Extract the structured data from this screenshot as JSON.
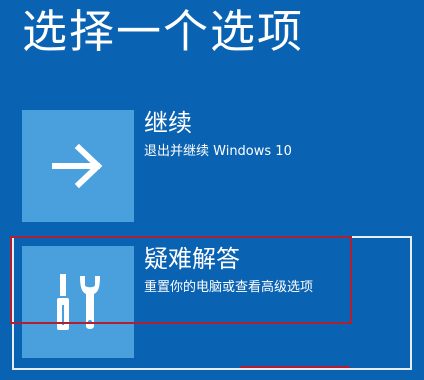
{
  "page": {
    "title": "选择一个选项"
  },
  "options": [
    {
      "title": "继续",
      "description": "退出并继续 Windows 10",
      "icon": "arrow-right-icon"
    },
    {
      "title": "疑难解答",
      "description": "重置你的电脑或查看高级选项",
      "icon": "tools-icon"
    }
  ],
  "colors": {
    "background": "#0a62b2",
    "tile": "#4aa0dc",
    "text": "#ffffff",
    "highlight_border": "#b02030"
  }
}
